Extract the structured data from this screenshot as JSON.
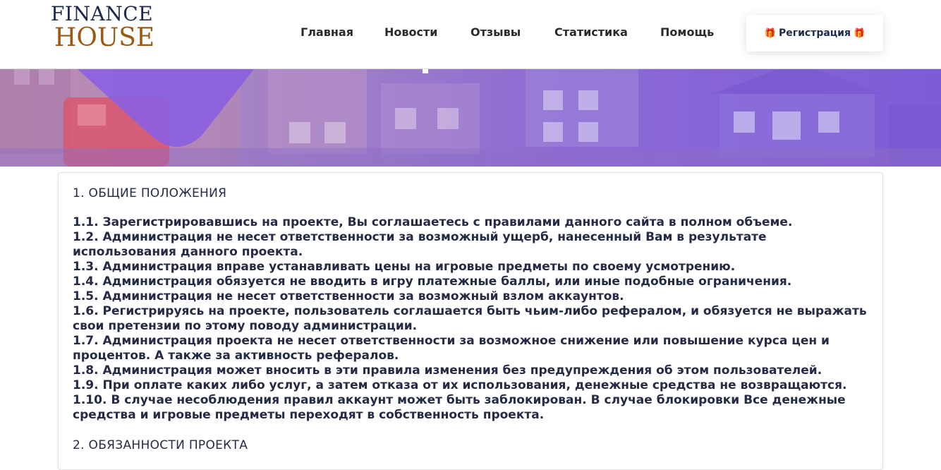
{
  "logo": {
    "line1": "FINANCE",
    "line2": "HOUSE"
  },
  "nav": {
    "items": [
      "Главная",
      "Новости",
      "Отзывы",
      "Статистика",
      "Помощь"
    ],
    "register_label": "Регистрация",
    "register_icon": "gift-icon"
  },
  "content": {
    "section1_title": "1. ОБЩИЕ ПОЛОЖЕНИЯ",
    "rules": [
      "1.1. Зарегистрировавшись на проекте, Вы соглашаетесь с правилами данного сайта в полном объеме.",
      "1.2. Администрация не несет ответственности за возможный ущерб, нанесенный Вам в результате использования данного проекта.",
      "1.3. Администрация вправе устанавливать цены на игровые предметы по своему усмотрению.",
      "1.4. Администрация обязуется не вводить в игру платежные баллы, или иные подобные ограничения.",
      "1.5. Администрация не несет ответственности за возможный взлом аккаунтов.",
      "1.6. Регистрируясь на проекте, пользователь соглашается быть чьим-либо рефералом, и обязуется не выражать свои претензии по этому поводу администрации.",
      "1.7. Администрация проекта не несет ответственности за возможное снижение или повышение курса цен и процентов. А также за активность рефералов.",
      "1.8. Администрация может вносить в эти правила изменения без предупреждения об этом пользователей.",
      "1.9. При оплате каких либо услуг, а затем отказа от их использования, денежные средства не возвращаются.",
      "1.10. В случае несоблюдения правил аккаунт может быть заблокирован. В случае блокировки Все денежные средства и игровые предметы переходят в собственность проекта."
    ],
    "section2_title": "2. ОБЯЗАННОСТИ ПРОЕКТА"
  },
  "colors": {
    "logo_dark": "#1f2a4a",
    "logo_accent": "#9a5a15",
    "banner_left": "#b78fb6",
    "banner_right": "#7d5cd8",
    "text": "#252a45"
  }
}
